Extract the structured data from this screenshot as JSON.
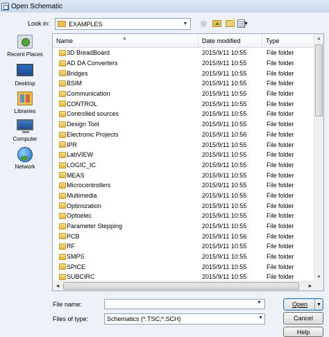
{
  "window": {
    "title": "Open Schematic"
  },
  "look_in": {
    "label": "Look in:",
    "value": "EXAMPLES"
  },
  "toolbar": {
    "back_icon": "back-arrow-icon",
    "up_icon": "up-folder-icon",
    "new_folder_icon": "new-folder-icon",
    "view_icon": "view-menu-icon"
  },
  "places": [
    {
      "label": "Recent Places",
      "icon": "recent-places-icon"
    },
    {
      "label": "Desktop",
      "icon": "desktop-icon"
    },
    {
      "label": "Libraries",
      "icon": "libraries-icon"
    },
    {
      "label": "Computer",
      "icon": "computer-icon"
    },
    {
      "label": "Network",
      "icon": "network-icon"
    }
  ],
  "columns": {
    "name": "Name",
    "date": "Date modified",
    "type": "Type"
  },
  "files": [
    {
      "name": "3D BreadBoard",
      "date": "2015/9/11 10:55",
      "type": "File folder"
    },
    {
      "name": "AD DA Converters",
      "date": "2015/9/11 10:55",
      "type": "File folder"
    },
    {
      "name": "Bridges",
      "date": "2015/9/11 10:55",
      "type": "File folder"
    },
    {
      "name": "BSIM",
      "date": "2015/9/11 10:55",
      "type": "File folder"
    },
    {
      "name": "Communication",
      "date": "2015/9/11 10:55",
      "type": "File folder"
    },
    {
      "name": "CONTROL",
      "date": "2015/9/11 10:55",
      "type": "File folder"
    },
    {
      "name": "Controlled sources",
      "date": "2015/9/11 10:55",
      "type": "File folder"
    },
    {
      "name": "Design Tool",
      "date": "2015/9/11 10:55",
      "type": "File folder"
    },
    {
      "name": "Electronic Projects",
      "date": "2015/9/11 10:56",
      "type": "File folder"
    },
    {
      "name": "IPR",
      "date": "2015/9/11 10:55",
      "type": "File folder"
    },
    {
      "name": "LabVIEW",
      "date": "2015/9/11 10:55",
      "type": "File folder"
    },
    {
      "name": "LOGIC_IC",
      "date": "2015/9/11 10:55",
      "type": "File folder"
    },
    {
      "name": "MEAS",
      "date": "2015/9/11 10:55",
      "type": "File folder"
    },
    {
      "name": "Microcontrollers",
      "date": "2015/9/11 10:55",
      "type": "File folder"
    },
    {
      "name": "Multimedia",
      "date": "2015/9/11 10:55",
      "type": "File folder"
    },
    {
      "name": "Optimization",
      "date": "2015/9/11 10:55",
      "type": "File folder"
    },
    {
      "name": "Optoelec",
      "date": "2015/9/11 10:55",
      "type": "File folder"
    },
    {
      "name": "Parameter Stepping",
      "date": "2015/9/11 10:55",
      "type": "File folder"
    },
    {
      "name": "PCB",
      "date": "2015/9/11 10:56",
      "type": "File folder"
    },
    {
      "name": "RF",
      "date": "2015/9/11 10:55",
      "type": "File folder"
    },
    {
      "name": "SMPS",
      "date": "2015/9/11 10:55",
      "type": "File folder"
    },
    {
      "name": "SPICE",
      "date": "2015/9/11 10:55",
      "type": "File folder"
    },
    {
      "name": "SUBCIRC",
      "date": "2015/9/11 10:55",
      "type": "File folder"
    }
  ],
  "file_name": {
    "label": "File name:",
    "value": ""
  },
  "file_type": {
    "label": "Files of type:",
    "value": "Schematics (*.TSC;*.SCH)"
  },
  "buttons": {
    "open": "Open",
    "cancel": "Cancel",
    "help": "Help"
  }
}
